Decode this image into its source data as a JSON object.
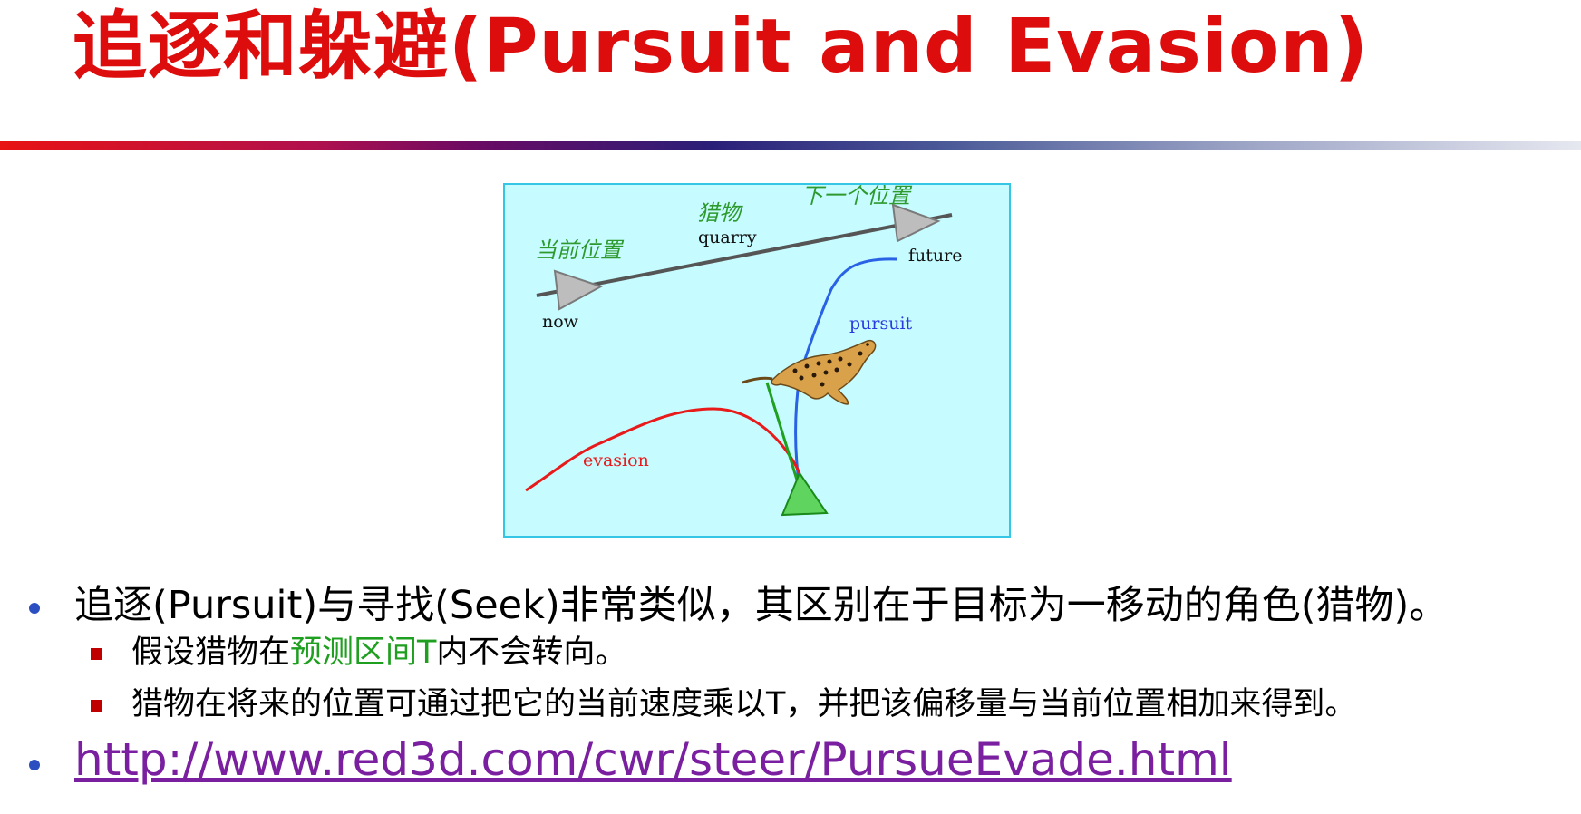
{
  "title": "追逐和躲避(Pursuit and Evasion)",
  "figure": {
    "labels": {
      "current_position_cn": "当前位置",
      "quarry_cn": "猎物",
      "next_position_cn": "下一个位置",
      "quarry": "quarry",
      "future": "future",
      "now": "now",
      "pursuit": "pursuit",
      "evasion": "evasion"
    },
    "colors": {
      "background": "#c6fbff",
      "border": "#35c6e6",
      "quarry_path": "#555555",
      "pursuit_path": "#2a62e6",
      "evasion_path": "#e81a1a",
      "pursuer_marker": "#1fa01f",
      "cn_labels": "#2e9a2e"
    },
    "icons": [
      "triangle-agent-icon",
      "cheetah-image"
    ]
  },
  "bullets": [
    {
      "text": "追逐(Pursuit)与寻找(Seek)非常类似，其区别在于目标为一移动的角色(猎物)。",
      "sub": [
        {
          "parts": [
            {
              "text": "假设猎物在",
              "color": "black"
            },
            {
              "text": "预测区间T",
              "color": "green"
            },
            {
              "text": "内不会转向。",
              "color": "black"
            }
          ]
        },
        {
          "parts": [
            {
              "text": "猎物在将来的位置可通过把它的当前速度乘以T，并把该偏移量与当前位置相加来得到。",
              "color": "black"
            }
          ]
        }
      ]
    },
    {
      "link": "http://www.red3d.com/cwr/steer/PursueEvade.html"
    }
  ],
  "colors": {
    "title": "#dd0d0d",
    "bullet_dot": "#2b4fc0",
    "sub_bullet": "#c00000",
    "highlight": "#1f9f1f",
    "link": "#7a1fa0"
  }
}
